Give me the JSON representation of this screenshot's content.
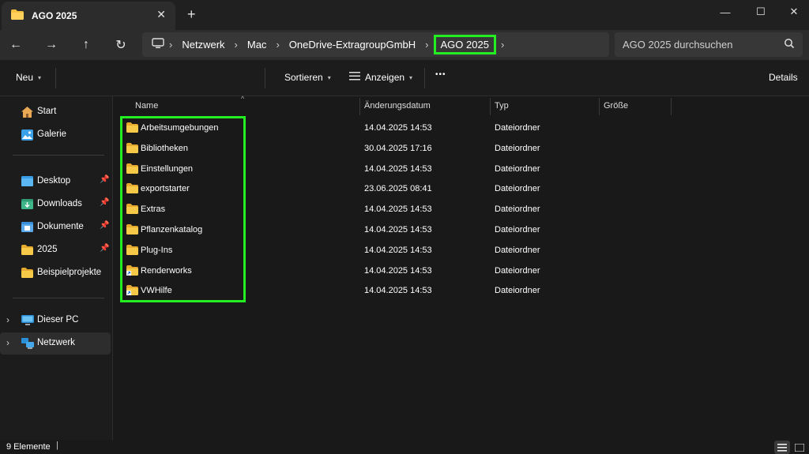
{
  "window": {
    "tab_title": "AGO 2025",
    "close_tab": "✕",
    "new_tab": "+",
    "minimize": "—",
    "maximize": "☐",
    "close": "✕"
  },
  "nav": {
    "back": "←",
    "forward": "→",
    "up": "↑",
    "refresh": "↻"
  },
  "breadcrumb": [
    "Netzwerk",
    "Mac",
    "OneDrive-ExtragroupGmbH",
    "AGO 2025"
  ],
  "search": {
    "placeholder": "AGO 2025 durchsuchen"
  },
  "toolbar": {
    "new_label": "Neu",
    "sort_label": "Sortieren",
    "view_label": "Anzeigen",
    "more_label": "•••",
    "details_label": "Details"
  },
  "sidebar": {
    "quick": [
      {
        "label": "Start",
        "icon": "home-icon"
      },
      {
        "label": "Galerie",
        "icon": "gallery-icon"
      }
    ],
    "pinned": [
      {
        "label": "Desktop",
        "icon": "desktop-folder-icon",
        "pinned": true
      },
      {
        "label": "Downloads",
        "icon": "downloads-folder-icon",
        "pinned": true
      },
      {
        "label": "Dokumente",
        "icon": "documents-folder-icon",
        "pinned": true
      },
      {
        "label": "2025",
        "icon": "folder-icon",
        "pinned": true
      },
      {
        "label": "Beispielprojekte",
        "icon": "folder-icon",
        "pinned": false
      }
    ],
    "tree": [
      {
        "label": "Dieser PC",
        "icon": "pc-icon"
      },
      {
        "label": "Netzwerk",
        "icon": "network-icon",
        "selected": true
      }
    ]
  },
  "columns": {
    "name": "Name",
    "date": "Änderungsdatum",
    "type": "Typ",
    "size": "Größe"
  },
  "files": [
    {
      "name": "Arbeitsumgebungen",
      "date": "14.04.2025 14:53",
      "type": "Dateiordner",
      "icon": "folder-icon"
    },
    {
      "name": "Bibliotheken",
      "date": "30.04.2025 17:16",
      "type": "Dateiordner",
      "icon": "folder-icon"
    },
    {
      "name": "Einstellungen",
      "date": "14.04.2025 14:53",
      "type": "Dateiordner",
      "icon": "folder-icon"
    },
    {
      "name": "exportstarter",
      "date": "23.06.2025 08:41",
      "type": "Dateiordner",
      "icon": "folder-icon"
    },
    {
      "name": "Extras",
      "date": "14.04.2025 14:53",
      "type": "Dateiordner",
      "icon": "folder-icon"
    },
    {
      "name": "Pflanzenkatalog",
      "date": "14.04.2025 14:53",
      "type": "Dateiordner",
      "icon": "folder-icon"
    },
    {
      "name": "Plug-Ins",
      "date": "14.04.2025 14:53",
      "type": "Dateiordner",
      "icon": "folder-icon"
    },
    {
      "name": "Renderworks",
      "date": "14.04.2025 14:53",
      "type": "Dateiordner",
      "icon": "folder-shortcut-icon"
    },
    {
      "name": "VWHilfe",
      "date": "14.04.2025 14:53",
      "type": "Dateiordner",
      "icon": "folder-shortcut-icon"
    }
  ],
  "status": {
    "count": "9 Elemente",
    "pipe": "|"
  },
  "colors": {
    "highlight": "#22ee22",
    "folder": "#f5c242",
    "background": "#191919"
  }
}
